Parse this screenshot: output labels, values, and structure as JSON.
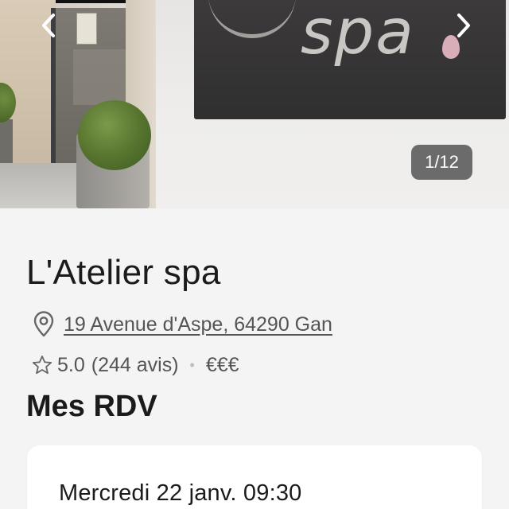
{
  "gallery": {
    "counter": "1/12",
    "sign_text": "spa"
  },
  "salon": {
    "name": "L'Atelier spa",
    "address": "19 Avenue d'Aspe, 64290 Gan",
    "rating": "5.0",
    "reviews": "(244 avis)",
    "separator": "•",
    "price_level": "€€€"
  },
  "appointments": {
    "section_title": "Mes RDV",
    "items": [
      {
        "date": "Mercredi 22 janv. 09:30"
      }
    ]
  },
  "icons": {
    "prev": "chevron-left-icon",
    "next": "chevron-right-icon",
    "location": "location-pin-icon",
    "rating": "star-outline-icon"
  },
  "colors": {
    "background": "#f4f4f4",
    "text_primary": "#1b1b1b",
    "text_secondary": "#555555",
    "counter_bg": "#4e4e4e",
    "card_bg": "#ffffff"
  }
}
